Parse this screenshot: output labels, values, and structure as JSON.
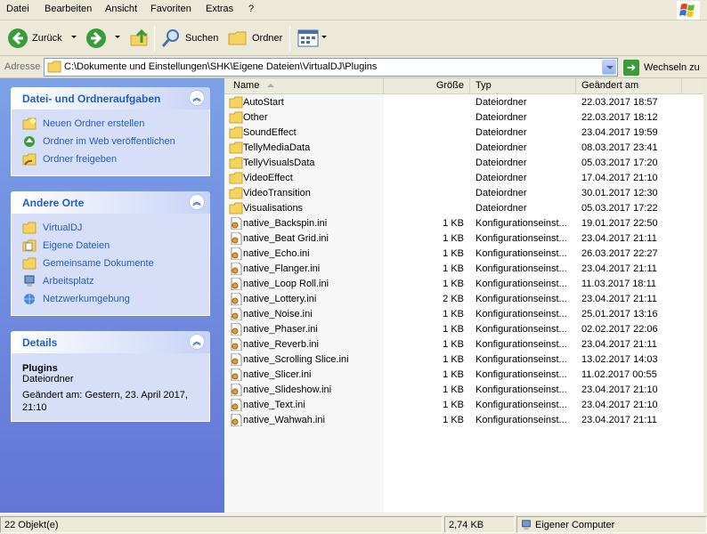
{
  "menu": [
    "Datei",
    "Bearbeiten",
    "Ansicht",
    "Favoriten",
    "Extras",
    "?"
  ],
  "toolbar": {
    "back_label": "Zurück",
    "search_label": "Suchen",
    "folders_label": "Ordner"
  },
  "address": {
    "label": "Adresse",
    "path": "C:\\Dokumente und Einstellungen\\SHK\\Eigene Dateien\\VirtualDJ\\Plugins",
    "go_label": "Wechseln zu"
  },
  "tasks_panel": {
    "title": "Datei- und Ordneraufgaben",
    "items": [
      "Neuen Ordner erstellen",
      "Ordner im Web veröffentlichen",
      "Ordner freigeben"
    ]
  },
  "places_panel": {
    "title": "Andere Orte",
    "items": [
      "VirtualDJ",
      "Eigene Dateien",
      "Gemeinsame Dokumente",
      "Arbeitsplatz",
      "Netzwerkumgebung"
    ]
  },
  "details_panel": {
    "title": "Details",
    "name": "Plugins",
    "type": "Dateiordner",
    "modified": "Geändert am: Gestern, 23. April 2017, 21:10"
  },
  "columns": {
    "name": "Name",
    "size": "Größe",
    "type": "Typ",
    "modified": "Geändert am"
  },
  "files": [
    {
      "name": "AutoStart",
      "size": "",
      "type": "Dateiordner",
      "date": "22.03.2017 18:57",
      "kind": "folder"
    },
    {
      "name": "Other",
      "size": "",
      "type": "Dateiordner",
      "date": "22.03.2017 18:12",
      "kind": "folder"
    },
    {
      "name": "SoundEffect",
      "size": "",
      "type": "Dateiordner",
      "date": "23.04.2017 19:59",
      "kind": "folder"
    },
    {
      "name": "TellyMediaData",
      "size": "",
      "type": "Dateiordner",
      "date": "08.03.2017 23:41",
      "kind": "folder"
    },
    {
      "name": "TellyVisualsData",
      "size": "",
      "type": "Dateiordner",
      "date": "05.03.2017 17:20",
      "kind": "folder"
    },
    {
      "name": "VideoEffect",
      "size": "",
      "type": "Dateiordner",
      "date": "17.04.2017 21:10",
      "kind": "folder"
    },
    {
      "name": "VideoTransition",
      "size": "",
      "type": "Dateiordner",
      "date": "30.01.2017 12:30",
      "kind": "folder"
    },
    {
      "name": "Visualisations",
      "size": "",
      "type": "Dateiordner",
      "date": "05.03.2017 17:22",
      "kind": "folder"
    },
    {
      "name": "native_Backspin.ini",
      "size": "1 KB",
      "type": "Konfigurationseinst...",
      "date": "19.01.2017 22:50",
      "kind": "ini"
    },
    {
      "name": "native_Beat Grid.ini",
      "size": "1 KB",
      "type": "Konfigurationseinst...",
      "date": "23.04.2017 21:11",
      "kind": "ini"
    },
    {
      "name": "native_Echo.ini",
      "size": "1 KB",
      "type": "Konfigurationseinst...",
      "date": "26.03.2017 22:27",
      "kind": "ini"
    },
    {
      "name": "native_Flanger.ini",
      "size": "1 KB",
      "type": "Konfigurationseinst...",
      "date": "23.04.2017 21:11",
      "kind": "ini"
    },
    {
      "name": "native_Loop Roll.ini",
      "size": "1 KB",
      "type": "Konfigurationseinst...",
      "date": "11.03.2017 18:11",
      "kind": "ini"
    },
    {
      "name": "native_Lottery.ini",
      "size": "2 KB",
      "type": "Konfigurationseinst...",
      "date": "23.04.2017 21:11",
      "kind": "ini"
    },
    {
      "name": "native_Noise.ini",
      "size": "1 KB",
      "type": "Konfigurationseinst...",
      "date": "25.01.2017 13:16",
      "kind": "ini"
    },
    {
      "name": "native_Phaser.ini",
      "size": "1 KB",
      "type": "Konfigurationseinst...",
      "date": "02.02.2017 22:06",
      "kind": "ini"
    },
    {
      "name": "native_Reverb.ini",
      "size": "1 KB",
      "type": "Konfigurationseinst...",
      "date": "23.04.2017 21:11",
      "kind": "ini"
    },
    {
      "name": "native_Scrolling Slice.ini",
      "size": "1 KB",
      "type": "Konfigurationseinst...",
      "date": "13.02.2017 14:03",
      "kind": "ini"
    },
    {
      "name": "native_Slicer.ini",
      "size": "1 KB",
      "type": "Konfigurationseinst...",
      "date": "11.02.2017 00:55",
      "kind": "ini"
    },
    {
      "name": "native_Slideshow.ini",
      "size": "1 KB",
      "type": "Konfigurationseinst...",
      "date": "23.04.2017 21:10",
      "kind": "ini"
    },
    {
      "name": "native_Text.ini",
      "size": "1 KB",
      "type": "Konfigurationseinst...",
      "date": "23.04.2017 21:10",
      "kind": "ini"
    },
    {
      "name": "native_Wahwah.ini",
      "size": "1 KB",
      "type": "Konfigurationseinst...",
      "date": "23.04.2017 21:11",
      "kind": "ini"
    }
  ],
  "status": {
    "objects": "22 Objekt(e)",
    "size": "2,74 KB",
    "location": "Eigener Computer"
  },
  "colors": {
    "folder": "#f4d35e",
    "link": "#215dc6",
    "taskpane_top": "#7ba2e7",
    "taskpane_bottom": "#6375d6"
  }
}
